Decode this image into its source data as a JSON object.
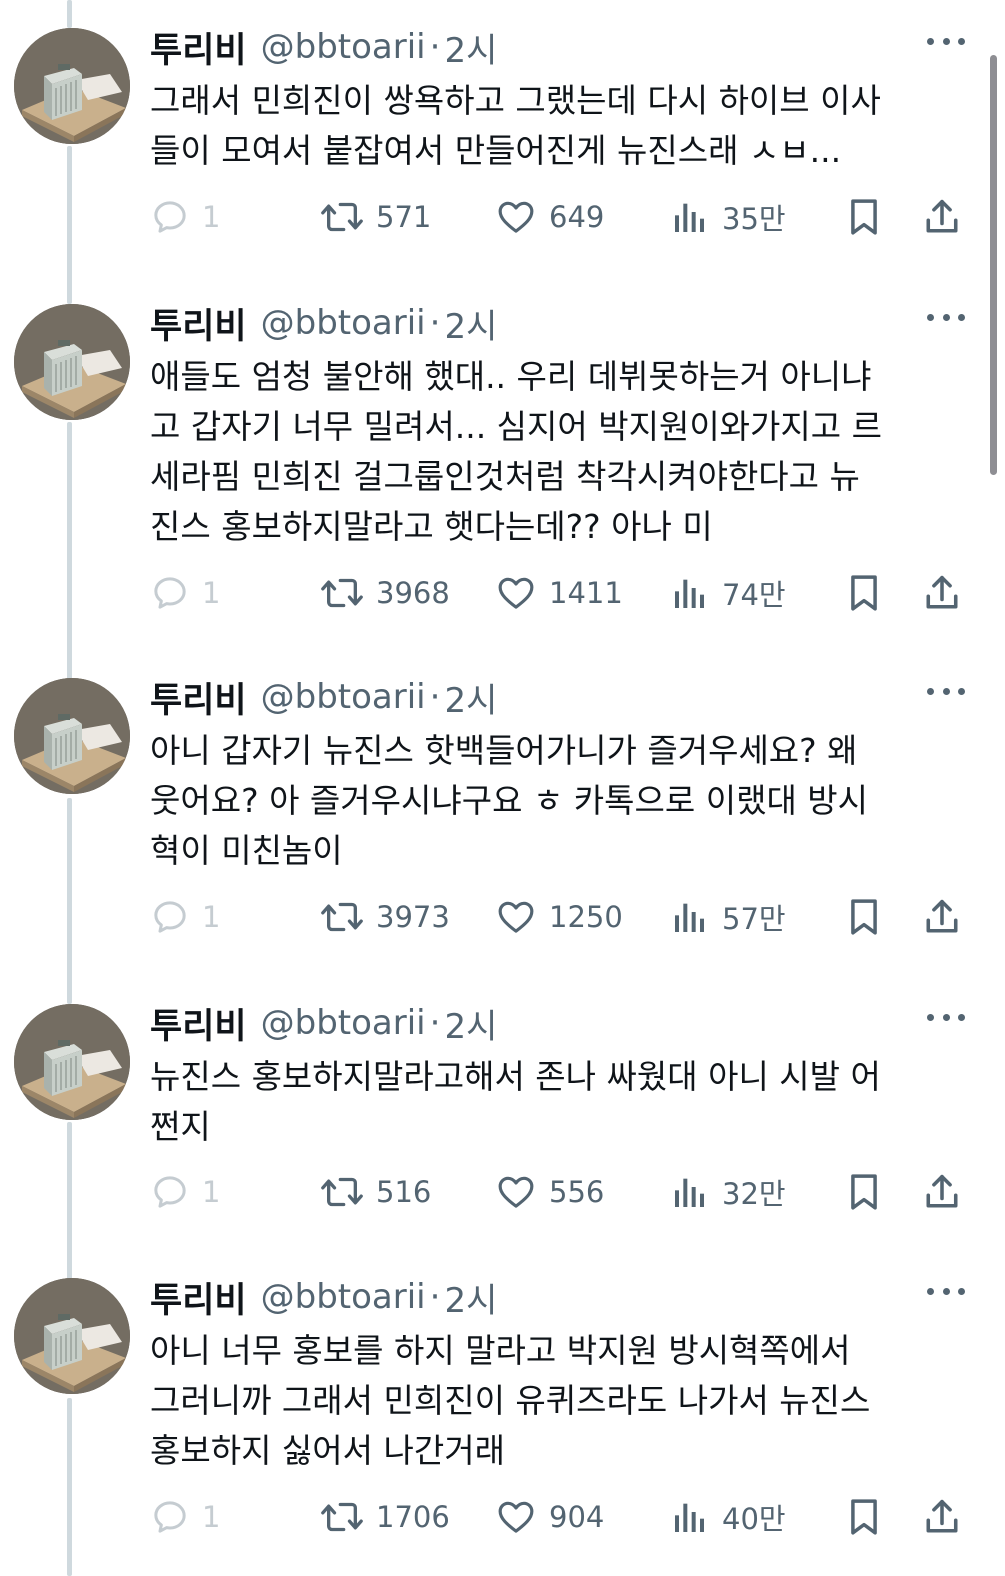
{
  "tweets": [
    {
      "name": "투리비",
      "handle": "@bbtoarii",
      "time": "2시",
      "text": "그래서 민희진이 쌍욕하고 그랬는데 다시 하이브 이사\n들이 모여서 붙잡여서 만들어진게 뉴진스래 ㅅㅂ...",
      "replies": "1",
      "retweets": "571",
      "likes": "649",
      "views": "35만"
    },
    {
      "name": "투리비",
      "handle": "@bbtoarii",
      "time": "2시",
      "text": "애들도 엄청 불안해 했대.. 우리 데뷔못하는거 아니냐\n고 갑자기 너무 밀려서... 심지어 박지원이와가지고 르\n세라핌 민희진 걸그룹인것처럼 착각시켜야한다고 뉴\n진스 홍보하지말라고 햇다는데?? 아나 미",
      "replies": "1",
      "retweets": "3968",
      "likes": "1411",
      "views": "74만"
    },
    {
      "name": "투리비",
      "handle": "@bbtoarii",
      "time": "2시",
      "text": "아니 갑자기 뉴진스 핫백들어가니가 즐거우세요? 왜\n웃어요? 아 즐거우시냐구요 ㅎ 카톡으로 이랬대 방시\n혁이 미친놈이",
      "replies": "1",
      "retweets": "3973",
      "likes": "1250",
      "views": "57만"
    },
    {
      "name": "투리비",
      "handle": "@bbtoarii",
      "time": "2시",
      "text": "뉴진스 홍보하지말라고해서 존나 싸웠대 아니 시발 어\n쩐지",
      "replies": "1",
      "retweets": "516",
      "likes": "556",
      "views": "32만"
    },
    {
      "name": "투리비",
      "handle": "@bbtoarii",
      "time": "2시",
      "text": "아니 너무 홍보를 하지 말라고 박지원 방시혁쪽에서\n그러니까 그래서 민희진이 유퀴즈라도 나가서 뉴진스\n홍보하지 싫어서 나간거래",
      "replies": "1",
      "retweets": "1706",
      "likes": "904",
      "views": "40만"
    }
  ],
  "icons": {
    "reply": "reply-bubble-icon",
    "retweet": "retweet-icon",
    "like": "heart-icon",
    "views": "views-bar-chart-icon",
    "bookmark": "bookmark-icon",
    "share": "share-upload-icon",
    "more": "more-dots-icon"
  },
  "colors": {
    "text": "#0f1419",
    "secondary": "#536471",
    "thread_line": "#cfd9de",
    "background": "#ffffff"
  }
}
